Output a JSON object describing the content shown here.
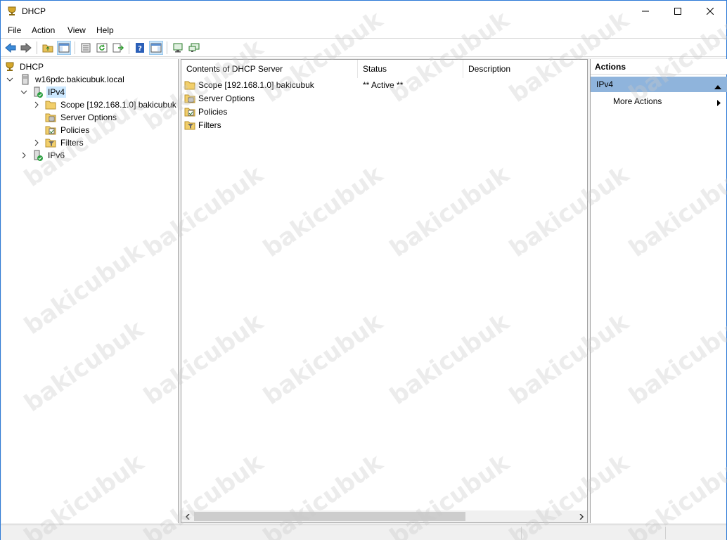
{
  "window": {
    "title": "DHCP"
  },
  "menu": [
    "File",
    "Action",
    "View",
    "Help"
  ],
  "tree": {
    "root": "DHCP",
    "server": "w16pdc.bakicubuk.local",
    "ipv4": "IPv4",
    "scope": "Scope [192.168.1.0] bakicubuk",
    "server_options": "Server Options",
    "policies": "Policies",
    "filters": "Filters",
    "ipv6": "IPv6"
  },
  "content": {
    "columns": [
      "Contents of DHCP Server",
      "Status",
      "Description"
    ],
    "rows": [
      {
        "name": "Scope [192.168.1.0] bakicubuk",
        "status": "** Active **",
        "icon": "folder-icon"
      },
      {
        "name": "Server Options",
        "status": "",
        "icon": "server-options-icon"
      },
      {
        "name": "Policies",
        "status": "",
        "icon": "policies-icon"
      },
      {
        "name": "Filters",
        "status": "",
        "icon": "filter-icon"
      }
    ]
  },
  "actions": {
    "title": "Actions",
    "group": "IPv4",
    "more": "More Actions"
  },
  "watermark": "bakicubuk",
  "colors": {
    "selection": "#cce8ff",
    "actions_header": "#8fb4dc",
    "border": "#2b79d6"
  }
}
